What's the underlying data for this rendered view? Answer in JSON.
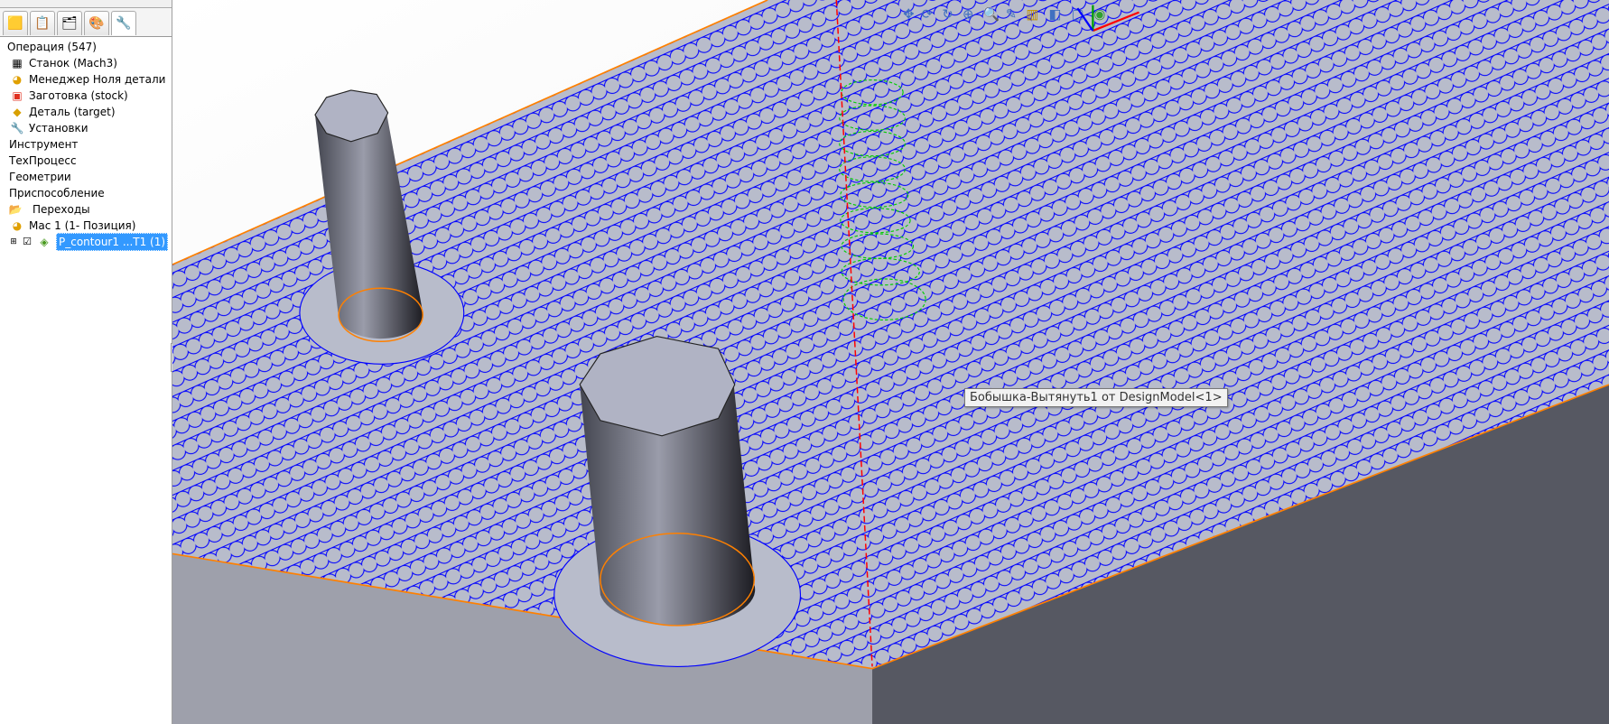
{
  "panel": {
    "tabs": [
      {
        "icon": "feature-tree-icon"
      },
      {
        "icon": "property-manager-icon"
      },
      {
        "icon": "configuration-manager-icon"
      },
      {
        "icon": "appearance-icon"
      },
      {
        "icon": "cam-manager-icon"
      }
    ],
    "tree": [
      {
        "label": "Операция (547)",
        "icon": "operation-icon"
      },
      {
        "label": "Станок (Mach3)",
        "icon": "machine-icon"
      },
      {
        "label": "Менеджер Ноля детали",
        "icon": "part-zero-icon"
      },
      {
        "label": "Заготовка (stock)",
        "icon": "stock-icon"
      },
      {
        "label": "Деталь (target)",
        "icon": "part-icon"
      },
      {
        "label": "Установки",
        "icon": "settings-wrench-icon"
      },
      {
        "label": "Инструмент",
        "icon": ""
      },
      {
        "label": "ТехПроцесс",
        "icon": ""
      },
      {
        "label": "Геометрии",
        "icon": ""
      },
      {
        "label": "Приспособление",
        "icon": ""
      },
      {
        "label": "Переходы",
        "icon": "folder-open-icon"
      },
      {
        "label": "Mac 1 (1- Позиция)",
        "icon": "part-zero-icon"
      },
      {
        "label": "P_contour1 ...T1 (1)",
        "icon": "toolpath-icon",
        "selected": true,
        "checked": true
      }
    ]
  },
  "viewport": {
    "toolbar": [
      "move-icon",
      "rotate-icon",
      "rotate-view-icon",
      "zoom-fit-icon",
      "zoom-area-icon",
      "section-icon",
      "view-orientation-icon",
      "display-style-icon",
      "hide-show-icon",
      "edit-appearance-icon",
      "scene-icon"
    ],
    "tooltip": "Бобышка-Вытянуть1 от DesignModel<1>",
    "colors": {
      "toolpath": "#0000ff",
      "edge": "#ff8000",
      "helix": "#00cc00",
      "axis": "#ff0000",
      "face": "#b8bccb",
      "side": "#565862"
    }
  }
}
